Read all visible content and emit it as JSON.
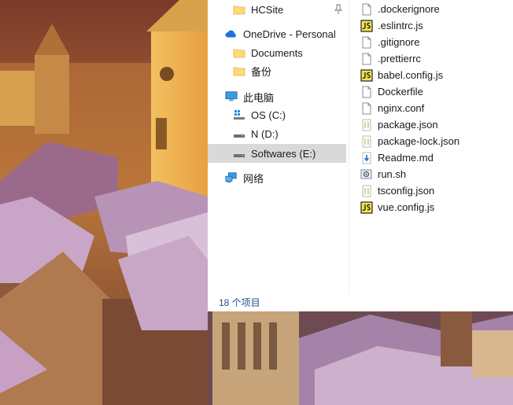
{
  "nav_pane": {
    "quick_access": [
      {
        "label": "HCSite",
        "icon": "folder-icon",
        "pinned": true
      }
    ],
    "onedrive": {
      "label": "OneDrive - Personal",
      "icon": "cloud-icon",
      "children": [
        {
          "label": "Documents",
          "icon": "folder-icon"
        },
        {
          "label": "备份",
          "icon": "folder-icon"
        }
      ]
    },
    "this_pc": {
      "label": "此电脑",
      "icon": "computer-icon",
      "drives": [
        {
          "label": "OS (C:)",
          "icon": "windows-drive-icon",
          "selected": false
        },
        {
          "label": "N (D:)",
          "icon": "drive-icon",
          "selected": false
        },
        {
          "label": "Softwares (E:)",
          "icon": "drive-icon",
          "selected": true
        }
      ]
    },
    "network": {
      "label": "网络",
      "icon": "network-icon"
    }
  },
  "files": [
    {
      "name": ".dockerignore",
      "icon": "text-file-icon"
    },
    {
      "name": ".eslintrc.js",
      "icon": "js-file-icon"
    },
    {
      "name": ".gitignore",
      "icon": "text-file-icon"
    },
    {
      "name": ".prettierrc",
      "icon": "text-file-icon"
    },
    {
      "name": "babel.config.js",
      "icon": "js-file-icon"
    },
    {
      "name": "Dockerfile",
      "icon": "text-file-icon"
    },
    {
      "name": "nginx.conf",
      "icon": "text-file-icon"
    },
    {
      "name": "package.json",
      "icon": "json-file-icon"
    },
    {
      "name": "package-lock.json",
      "icon": "json-file-icon"
    },
    {
      "name": "Readme.md",
      "icon": "markdown-file-icon"
    },
    {
      "name": "run.sh",
      "icon": "shell-script-icon"
    },
    {
      "name": "tsconfig.json",
      "icon": "json-file-icon"
    },
    {
      "name": "vue.config.js",
      "icon": "js-file-icon"
    }
  ],
  "status_bar": {
    "item_count": "18 个项目"
  },
  "colors": {
    "selection": "#d9d9d9",
    "folder": "#ffd978",
    "onedrive": "#1e74d8",
    "status_text": "#1f4e8c",
    "js_badge": "#f3e24b"
  }
}
